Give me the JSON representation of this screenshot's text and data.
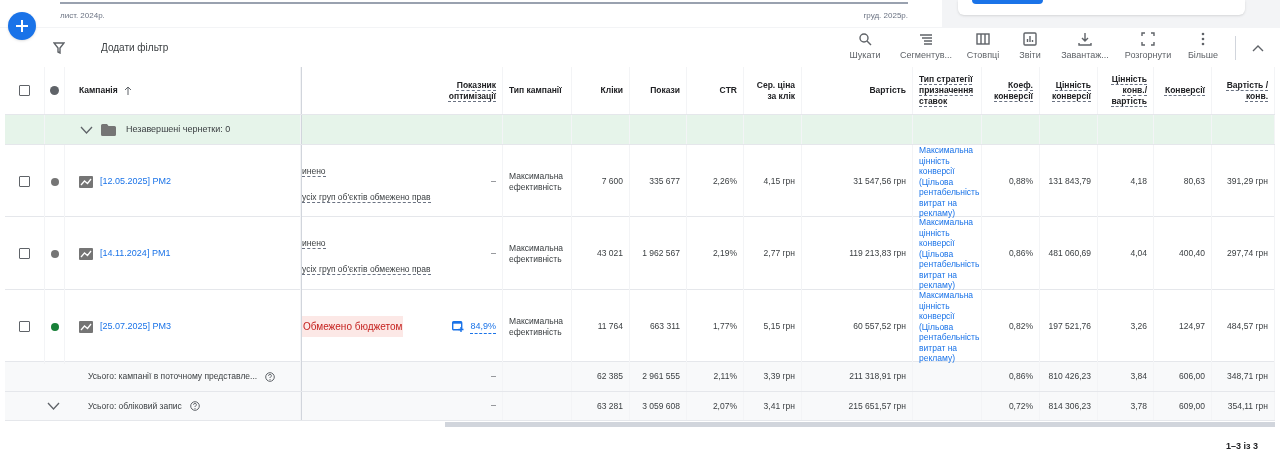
{
  "date_range": {
    "start": "лист. 2024р.",
    "end": "груд. 2025р."
  },
  "toolbar": {
    "filter": "Додати фільтр",
    "tools": [
      {
        "kind": "search",
        "label": "Шукати"
      },
      {
        "kind": "segment",
        "label": "Сегментув..."
      },
      {
        "kind": "columns",
        "label": "Стовпці"
      },
      {
        "kind": "reports",
        "label": "Звіти"
      },
      {
        "kind": "download",
        "label": "Завантаж..."
      },
      {
        "kind": "expand",
        "label": "Розгорнути"
      },
      {
        "kind": "more",
        "label": "Більше"
      }
    ]
  },
  "table": {
    "all_selected": false,
    "campaign_column": {
      "label": "Кампанія",
      "sorted": true
    },
    "optimization_column": {
      "label": "Показник оптимізації",
      "underlined": true
    },
    "columns": [
      {
        "label": "Тип кампанії",
        "underlined": false
      },
      {
        "label": "Кліки",
        "underlined": false
      },
      {
        "label": "Покази",
        "underlined": false
      },
      {
        "label": "CTR",
        "underlined": false
      },
      {
        "label": "Сер. ціна за клік",
        "underlined": false
      },
      {
        "label": "Вартість",
        "underlined": false
      },
      {
        "label": "Тип стратегії призначення ставок",
        "underlined": true
      },
      {
        "label": "Коеф. конверсії",
        "underlined": true
      },
      {
        "label": "Цінність конверсії",
        "underlined": true
      },
      {
        "label": "Цінність конв./вартість",
        "underlined": true
      },
      {
        "label": "Конверсії",
        "underlined": true
      },
      {
        "label": "Вартість / конв.",
        "underlined": true
      }
    ],
    "drafts": {
      "label": "Незавершені чернетки: 0",
      "expanded": false
    },
    "rows": [
      {
        "selected": false,
        "color": "#757575",
        "name": "[12.05.2025] PM2",
        "status": {
          "kind": "text",
          "lines": [
            "инено",
            "усіх груп об'єктів обмежено прав"
          ]
        },
        "optimization": {
          "text": "–",
          "icon": false
        },
        "cells": [
          "Максимальна ефективність",
          "7 600",
          "335 677",
          "2,26%",
          "4,15 грн",
          "31 547,56 грн",
          "Максимальна цінність конверсії (Цільова рентабельність витрат на рекламу)",
          "0,88%",
          "131 843,79",
          "4,18",
          "80,63",
          "391,29 грн"
        ]
      },
      {
        "selected": false,
        "color": "#757575",
        "name": "[14.11.2024] PM1",
        "status": {
          "kind": "text",
          "lines": [
            "инено",
            "усіх груп об'єктів обмежено прав"
          ]
        },
        "optimization": {
          "text": "–",
          "icon": false
        },
        "cells": [
          "Максимальна ефективність",
          "43 021",
          "1 962 567",
          "2,19%",
          "2,77 грн",
          "119 213,83 грн",
          "Максимальна цінність конверсії (Цільова рентабельність витрат на рекламу)",
          "0,86%",
          "481 060,69",
          "4,04",
          "400,40",
          "297,74 грн"
        ]
      },
      {
        "selected": false,
        "color": "#188038",
        "name": "[25.07.2025] PM3",
        "status": {
          "kind": "badge",
          "text": "Обмежено бюджетом"
        },
        "optimization": {
          "text": "84,9%",
          "icon": true
        },
        "cells": [
          "Максимальна ефективність",
          "11 764",
          "663 311",
          "1,77%",
          "5,15 грн",
          "60 557,52 грн",
          "Максимальна цінність конверсії (Цільова рентабельність витрат на рекламу)",
          "0,82%",
          "197 521,76",
          "3,26",
          "124,97",
          "484,57 грн"
        ]
      }
    ],
    "totals": [
      {
        "label": "Усього: кампанії в поточному представле...",
        "optimization": "–",
        "cells": [
          null,
          "62 385",
          "2 961 555",
          "2,11%",
          "3,39 грн",
          "211 318,91 грн",
          null,
          "0,86%",
          "810 426,23",
          "3,84",
          "606,00",
          "348,71 грн"
        ]
      },
      {
        "label": "Усього: обліковий запис",
        "expanded": false,
        "optimization": "–",
        "cells": [
          null,
          "63 281",
          "3 059 608",
          "2,07%",
          "3,41 грн",
          "215 651,57 грн",
          null,
          "0,72%",
          "814 306,23",
          "3,78",
          "609,00",
          "354,11 грн"
        ]
      }
    ]
  },
  "pagination": "1–3 із 3"
}
